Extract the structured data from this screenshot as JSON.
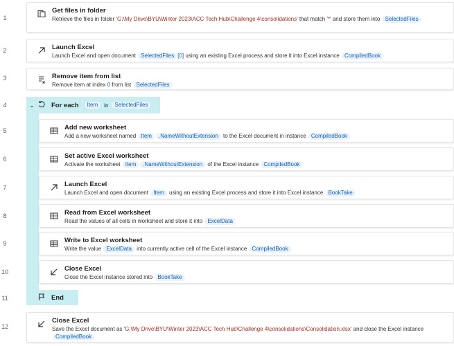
{
  "rows": [
    {
      "num": "1",
      "title": "Get files in folder",
      "icon": "folder-files-icon",
      "desc": {
        "t1": "Retrieve the files in folder ",
        "s1": "'G:\\My Drive\\BYU\\Winter 2023\\ACC Tech Hub\\Challenge 4\\consolidations'",
        "t2": " that match ",
        "s2": "'*'",
        "t3": " and store them into ",
        "v1": "SelectedFiles"
      }
    },
    {
      "num": "2",
      "title": "Launch Excel",
      "icon": "launch-arrow-icon",
      "desc": {
        "t1": "Launch Excel and open document ",
        "v1": "SelectedFiles",
        "n1": "[0]",
        "t2": " using an existing Excel process and store it into Excel instance ",
        "v2": "CompiledBook"
      }
    },
    {
      "num": "3",
      "title": "Remove item from list",
      "icon": "list-remove-icon",
      "desc": {
        "t1": "Remove item at index ",
        "n1": "0",
        "t2": " from list ",
        "v1": "SelectedFiles"
      }
    },
    {
      "num": "4",
      "keyword": "For each",
      "v1": "Item",
      "in": "in",
      "v2": "SelectedFiles",
      "icon": "loop-icon"
    },
    {
      "num": "5",
      "title": "Add new worksheet",
      "icon": "excel-sheet-icon",
      "desc": {
        "t1": "Add a new worksheet named ",
        "v1": "Item",
        "v2": ".NameWithoutExtension",
        "t2": " to the Excel document in instance ",
        "v3": "CompiledBook"
      }
    },
    {
      "num": "6",
      "title": "Set active Excel worksheet",
      "icon": "excel-sheet-icon",
      "desc": {
        "t1": "Activate the worksheet ",
        "v1": "Item",
        "v2": ".NameWithoutExtension",
        "t2": " of the Excel instance ",
        "v3": "CompiledBook"
      }
    },
    {
      "num": "7",
      "title": "Launch Excel",
      "icon": "launch-arrow-icon",
      "desc": {
        "t1": "Launch Excel and open document ",
        "v1": "Item",
        "t2": " using an existing Excel process and store it into Excel instance ",
        "v2": "BookTake"
      }
    },
    {
      "num": "8",
      "title": "Read from Excel worksheet",
      "icon": "excel-sheet-icon",
      "desc": {
        "t1": "Read the values of all cells in worksheet and store it into ",
        "v1": "ExcelData"
      }
    },
    {
      "num": "9",
      "title": "Write to Excel worksheet",
      "icon": "excel-sheet-icon",
      "desc": {
        "t1": "Write the value ",
        "v1": "ExcelData",
        "t2": " into currently active cell of the Excel instance ",
        "v2": "CompiledBook"
      }
    },
    {
      "num": "10",
      "title": "Close Excel",
      "icon": "close-arrow-icon",
      "desc": {
        "t1": "Close the Excel instance stored into ",
        "v1": "BookTake"
      }
    },
    {
      "num": "11",
      "keyword": "End",
      "icon": "flag-icon"
    },
    {
      "num": "12",
      "title": "Close Excel",
      "icon": "close-arrow-icon",
      "desc": {
        "t1": "Save the Excel document as ",
        "s1": "'G:\\My Drive\\BYU\\Winter 2023\\ACC Tech Hub\\Challenge 4\\consolidations\\Consolidation.xlsx'",
        "t2": " and close the Excel instance ",
        "v1": "CompiledBook"
      }
    }
  ]
}
